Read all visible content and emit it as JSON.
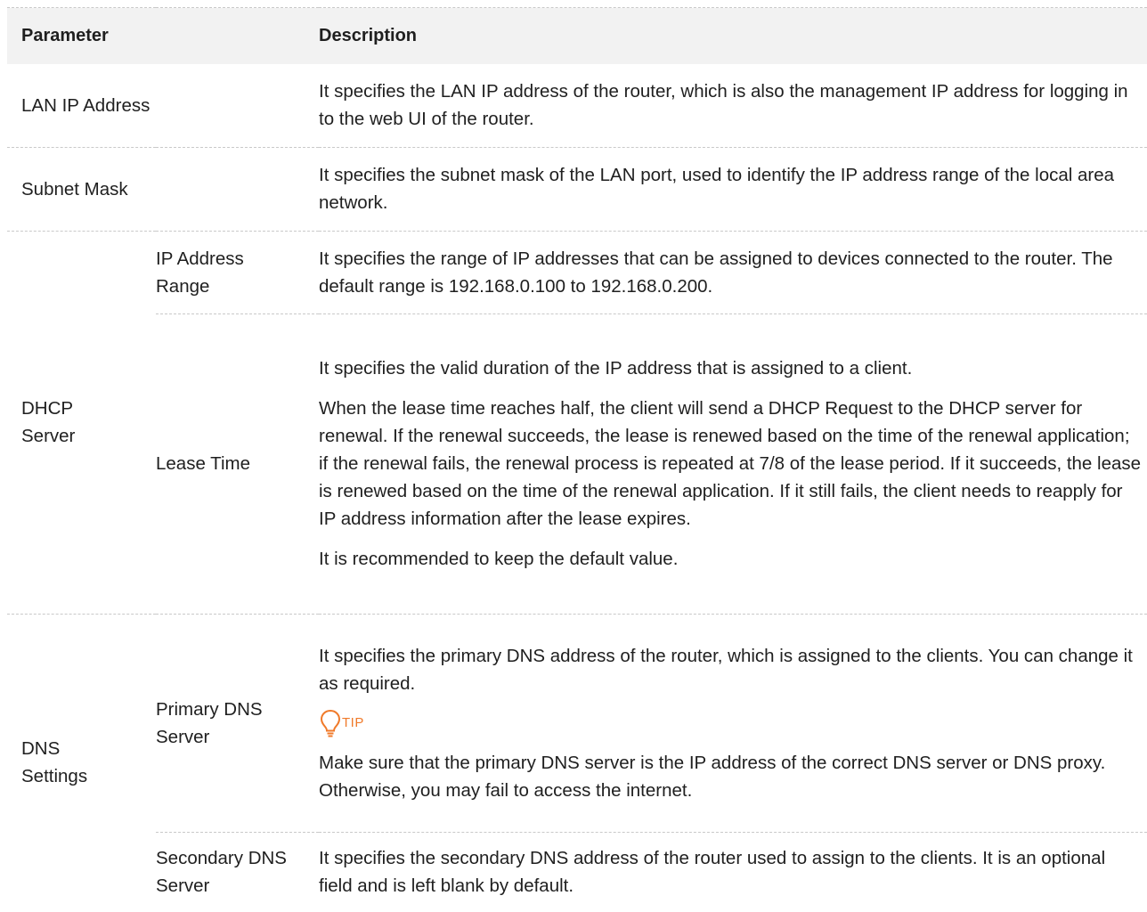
{
  "table": {
    "headers": {
      "parameter": "Parameter",
      "description": "Description"
    },
    "rows": {
      "lan_ip": {
        "label": "LAN IP Address",
        "description": "It specifies the LAN IP address of the router, which is also the management IP address for logging in to the web UI of the router."
      },
      "subnet_mask": {
        "label": "Subnet Mask",
        "description": "It specifies the subnet mask of the LAN port, used to identify the IP address range of the local area network."
      },
      "dhcp_server": {
        "label": "DHCP Server",
        "ip_range": {
          "label": "IP Address Range",
          "description": "It specifies the range of IP addresses that can be assigned to devices connected to the router. The default range is 192.168.0.100 to 192.168.0.200."
        },
        "lease_time": {
          "label": "Lease Time",
          "description_1": "It specifies the valid duration of the IP address that is assigned to a client.",
          "description_2": "When the lease time reaches half, the client will send a DHCP Request to the DHCP server for renewal. If the renewal succeeds, the lease is renewed based on the time of the renewal application; if the renewal fails, the renewal process is repeated at 7/8 of the lease period. If it succeeds, the lease is renewed based on the time of the renewal application. If it still fails, the client needs to reapply for IP address information after the lease expires.",
          "description_3": "It is recommended to keep the default value."
        }
      },
      "dns_settings": {
        "label": "DNS Settings",
        "primary": {
          "label": "Primary DNS Server",
          "description": "It specifies the primary DNS address of the router, which is assigned to the clients. You can change it as required.",
          "tip_label": "TIP",
          "tip_icon": "lightbulb-icon",
          "tip_text": "Make sure that the primary DNS server is the IP address of the correct DNS server or DNS proxy. Otherwise, you may fail to access the internet."
        },
        "secondary": {
          "label": "Secondary DNS Server",
          "description": "It specifies the secondary DNS address of the router used to assign to the clients. It is an optional field and is left blank by default."
        }
      }
    }
  },
  "colors": {
    "header_bg": "#f2f2f2",
    "tip_accent": "#f07a2a",
    "divider": "#c9c9c9"
  }
}
